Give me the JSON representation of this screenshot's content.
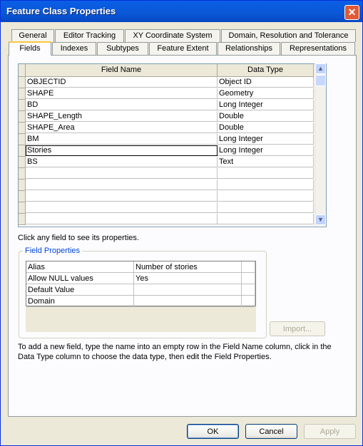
{
  "window": {
    "title": "Feature Class Properties",
    "close_glyph": "✕"
  },
  "tabs_top": [
    "General",
    "Editor Tracking",
    "XY Coordinate System",
    "Domain, Resolution and Tolerance"
  ],
  "tabs_bottom": [
    "Fields",
    "Indexes",
    "Subtypes",
    "Feature Extent",
    "Relationships",
    "Representations"
  ],
  "active_tab": "Fields",
  "grid": {
    "columns": [
      "Field Name",
      "Data Type"
    ],
    "rows": [
      {
        "name": "OBJECTID",
        "type": "Object ID"
      },
      {
        "name": "SHAPE",
        "type": "Geometry"
      },
      {
        "name": "BD",
        "type": "Long Integer"
      },
      {
        "name": "SHAPE_Length",
        "type": "Double"
      },
      {
        "name": "SHAPE_Area",
        "type": "Double"
      },
      {
        "name": "BM",
        "type": "Long Integer"
      },
      {
        "name": "Stories",
        "type": "Long Integer"
      },
      {
        "name": "BS",
        "type": "Text"
      },
      {
        "name": "",
        "type": ""
      },
      {
        "name": "",
        "type": ""
      },
      {
        "name": "",
        "type": ""
      },
      {
        "name": "",
        "type": ""
      },
      {
        "name": "",
        "type": ""
      }
    ],
    "selected_row": 6
  },
  "hint": "Click any field to see its properties.",
  "field_properties": {
    "legend": "Field Properties",
    "rows": [
      {
        "label": "Alias",
        "value": "Number of stories"
      },
      {
        "label": "Allow NULL values",
        "value": "Yes"
      },
      {
        "label": "Default Value",
        "value": ""
      },
      {
        "label": "Domain",
        "value": ""
      }
    ]
  },
  "import_label": "Import...",
  "instructions": "To add a new field, type the name into an empty row in the Field Name column, click in the Data Type column to choose the data type, then edit the Field Properties.",
  "buttons": {
    "ok": "OK",
    "cancel": "Cancel",
    "apply": "Apply"
  }
}
